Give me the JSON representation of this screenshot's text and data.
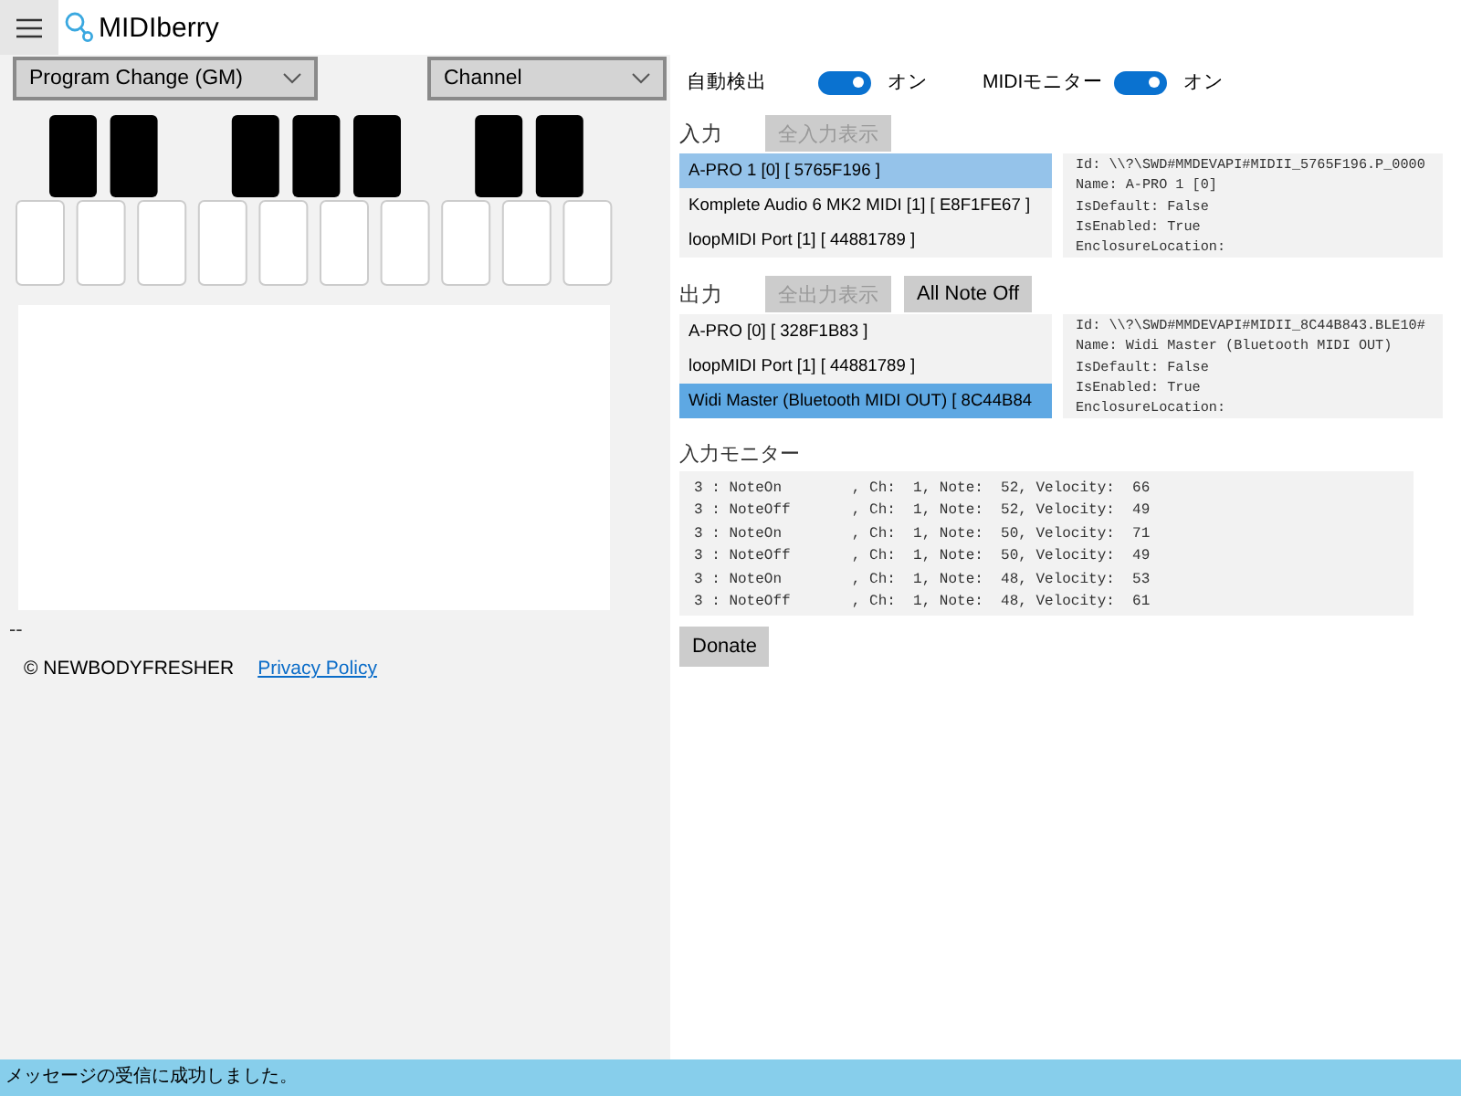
{
  "window": {
    "title": "MIDIberry"
  },
  "left": {
    "dropdowns": [
      {
        "value": "Program Change (GM)"
      },
      {
        "value": "Channel"
      }
    ],
    "status_label": "--",
    "copyright": "© NEWBODYFRESHER",
    "privacy_link": "Privacy Policy"
  },
  "toggles": [
    {
      "label": "自動検出",
      "on": true,
      "state_text": "オン"
    },
    {
      "label": "MIDIモニター",
      "on": true,
      "state_text": "オン"
    }
  ],
  "input": {
    "label": "入力",
    "buttons": [
      {
        "label": "全入力表示",
        "disabled": true
      }
    ],
    "items": [
      {
        "name": "A-PRO 1 [0] [ 5765F196 ]",
        "selected": true
      },
      {
        "name": "Komplete Audio 6 MK2 MIDI [1] [ E8F1FE67 ]",
        "selected": false
      },
      {
        "name": "loopMIDI Port [1] [ 44881789 ]",
        "selected": false
      }
    ],
    "details": [
      "Id: \\\\?\\SWD#MMDEVAPI#MIDII_5765F196.P_0000",
      "Name: A-PRO 1 [0]",
      "IsDefault: False",
      "IsEnabled: True",
      "EnclosureLocation:"
    ]
  },
  "output": {
    "label": "出力",
    "buttons": [
      {
        "label": "全出力表示",
        "disabled": true
      },
      {
        "label": "All Note Off",
        "disabled": false
      }
    ],
    "items": [
      {
        "name": "A-PRO [0] [ 328F1B83 ]",
        "selected": false
      },
      {
        "name": "loopMIDI Port [1] [ 44881789 ]",
        "selected": false
      },
      {
        "name": "Widi Master (Bluetooth MIDI OUT) [ 8C44B84",
        "selected": true
      }
    ],
    "details": [
      "Id: \\\\?\\SWD#MMDEVAPI#MIDII_8C44B843.BLE10#",
      "Name: Widi Master (Bluetooth MIDI OUT)",
      "IsDefault: False",
      "IsEnabled: True",
      "EnclosureLocation:"
    ]
  },
  "monitor": {
    "label": "入力モニター",
    "lines": [
      "3 : NoteOn        , Ch:  1, Note:  52, Velocity:  66",
      "3 : NoteOff       , Ch:  1, Note:  52, Velocity:  49",
      "3 : NoteOn        , Ch:  1, Note:  50, Velocity:  71",
      "3 : NoteOff       , Ch:  1, Note:  50, Velocity:  49",
      "3 : NoteOn        , Ch:  1, Note:  48, Velocity:  53",
      "3 : NoteOff       , Ch:  1, Note:  48, Velocity:  61"
    ]
  },
  "donate": "Donate",
  "status_bar": "メッセージの受信に成功しました。"
}
